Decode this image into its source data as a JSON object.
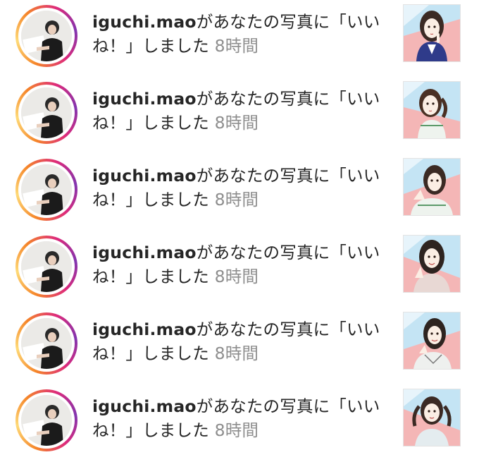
{
  "notifications": [
    {
      "username": "iguchi.mao",
      "action": "があなたの写真に「いいね！」しました",
      "time": "8時間"
    },
    {
      "username": "iguchi.mao",
      "action": "があなたの写真に「いいね！」しました",
      "time": "8時間"
    },
    {
      "username": "iguchi.mao",
      "action": "があなたの写真に「いいね！」しました",
      "time": "8時間"
    },
    {
      "username": "iguchi.mao",
      "action": "があなたの写真に「いいね！」しました",
      "time": "8時間"
    },
    {
      "username": "iguchi.mao",
      "action": "があなたの写真に「いいね！」しました",
      "time": "8時間"
    },
    {
      "username": "iguchi.mao",
      "action": "があなたの写真に「いいね！」しました",
      "time": "8時間"
    }
  ],
  "colors": {
    "text": "#262626",
    "time": "#8e8e8e",
    "ring_start": "#f58529",
    "ring_mid": "#dd2a7b",
    "ring_end": "#8134af",
    "thumb_pink": "#f4b6b6",
    "thumb_blue": "#c4e4f4"
  }
}
